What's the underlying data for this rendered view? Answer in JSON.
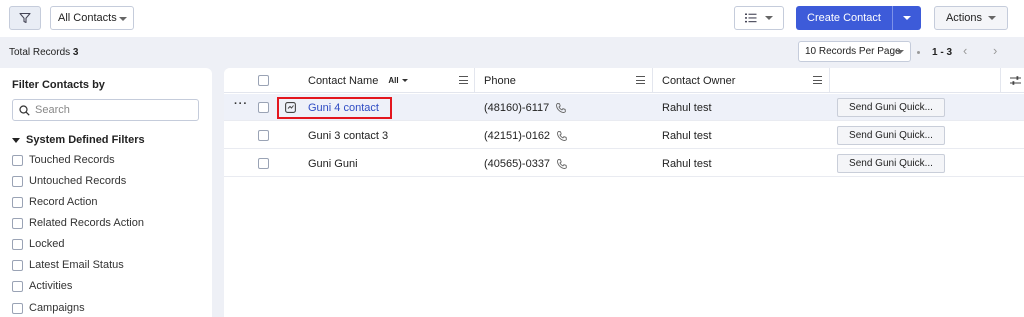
{
  "toolbar": {
    "view_select_label": "All Contacts",
    "create_label": "Create Contact",
    "actions_label": "Actions"
  },
  "summary": {
    "total_label": "Total Records",
    "total_count": "3",
    "per_page": "10 Records Per Page",
    "page_range": "1 - 3"
  },
  "sidebar": {
    "title": "Filter Contacts by",
    "search_placeholder": "Search",
    "section": "System Defined Filters",
    "items": [
      "Touched Records",
      "Untouched Records",
      "Record Action",
      "Related Records Action",
      "Locked",
      "Latest Email Status",
      "Activities",
      "Campaigns"
    ]
  },
  "table": {
    "headers": {
      "name": "Contact Name",
      "name_filter": "All",
      "phone": "Phone",
      "owner": "Contact Owner"
    },
    "rows": [
      {
        "name": "Guni 4 contact",
        "phone": "(48160)-6117",
        "owner": "Rahul test",
        "action": "Send Guni Quick..."
      },
      {
        "name": "Guni 3 contact 3",
        "phone": "(42151)-0162",
        "owner": "Rahul test",
        "action": "Send Guni Quick..."
      },
      {
        "name": "Guni Guni",
        "phone": "(40565)-0337",
        "owner": "Rahul test",
        "action": "Send Guni Quick..."
      }
    ]
  },
  "colors": {
    "accent": "#3d5bd9",
    "link": "#2f4cc4",
    "highlight": "#e3161e"
  }
}
